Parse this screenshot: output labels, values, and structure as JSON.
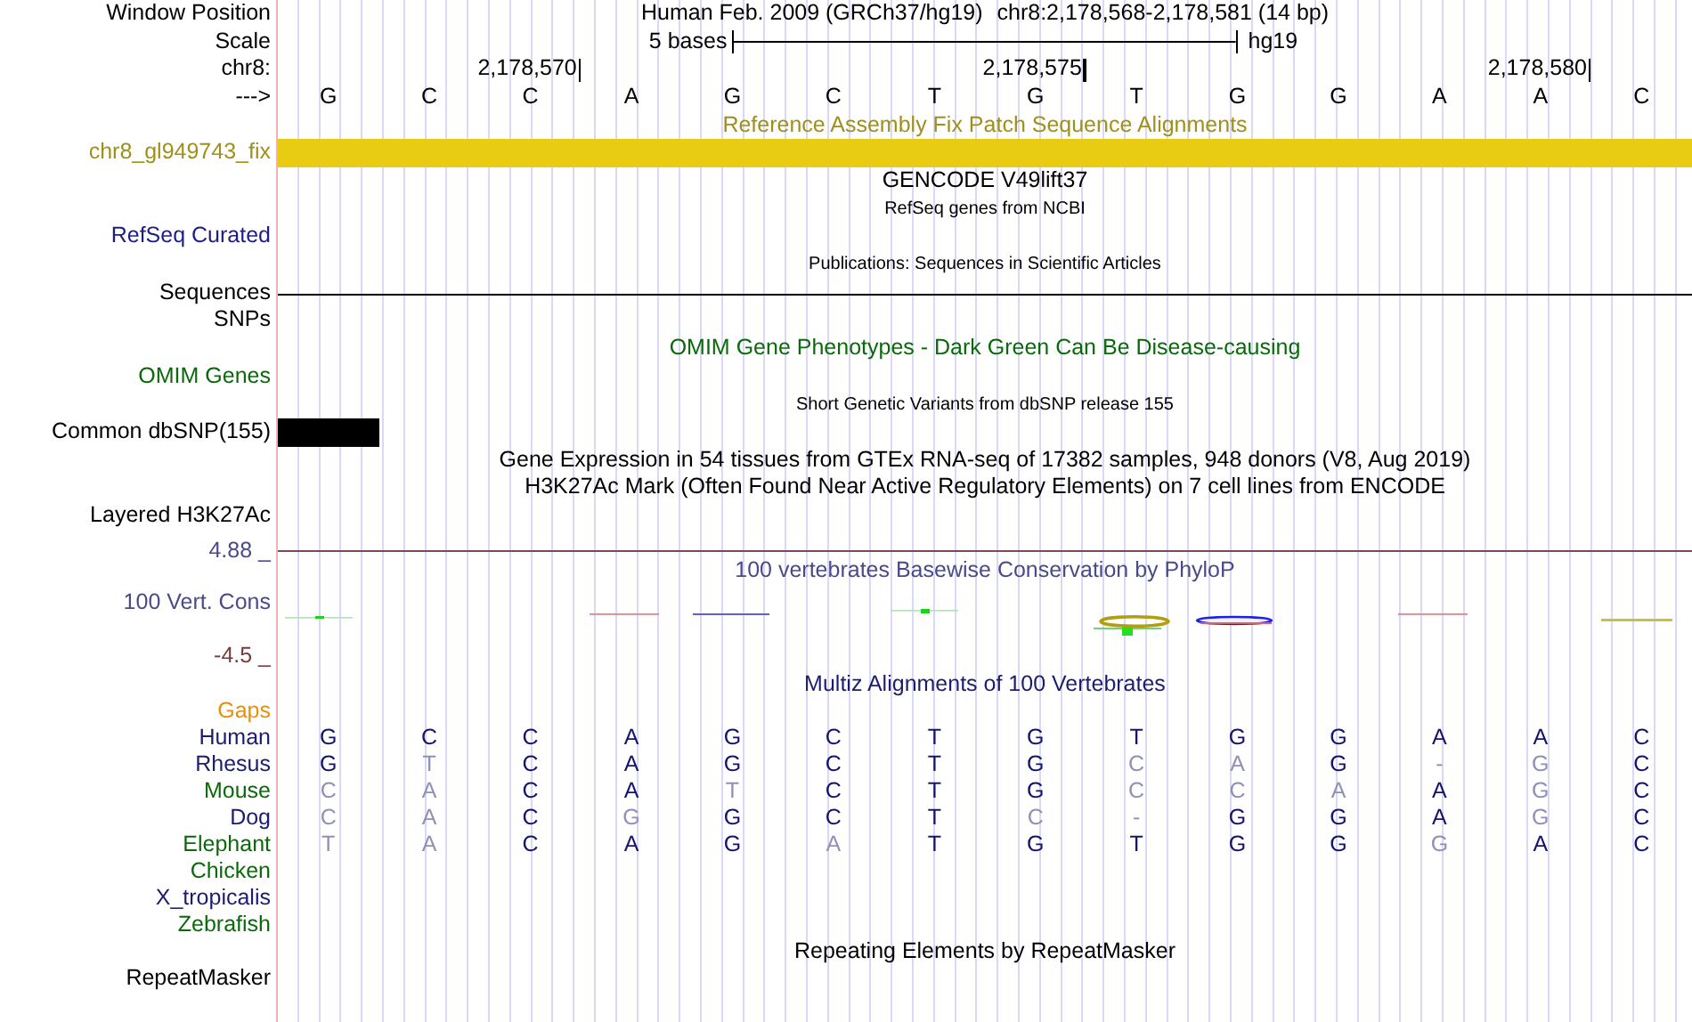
{
  "rows": [
    {
      "kind": "position",
      "label": "Window Position",
      "title": "Human Feb. 2009 (GRCh37/hg19)",
      "region": "chr8:2,178,568-2,178,581 (14 bp)"
    },
    {
      "kind": "scale",
      "label": "Scale",
      "scale_text": "5 bases",
      "assembly": "hg19"
    },
    {
      "kind": "coords",
      "label": "chr8:",
      "ticks": [
        "2,178,570",
        "2,178,575",
        "2,178,580"
      ]
    },
    {
      "kind": "bases",
      "label": "--->",
      "bases": [
        "G",
        "C",
        "C",
        "A",
        "G",
        "C",
        "T",
        "G",
        "T",
        "G",
        "G",
        "A",
        "A",
        "C"
      ]
    },
    {
      "kind": "title",
      "title": "Reference Assembly Fix Patch Sequence Alignments",
      "color": "#a0901a"
    },
    {
      "kind": "bar",
      "label": "chr8_gl949743_fix",
      "color": "#a0901a"
    },
    {
      "kind": "title",
      "title": "GENCODE V49lift37",
      "color": "#000000"
    },
    {
      "kind": "subtitle",
      "title": "RefSeq genes from NCBI"
    },
    {
      "kind": "label",
      "label": "RefSeq Curated",
      "color": "#1c1c8c"
    },
    {
      "kind": "subtitle",
      "title": "Publications: Sequences in Scientific Articles"
    },
    {
      "kind": "line",
      "label": "Sequences"
    },
    {
      "kind": "label",
      "label": "SNPs",
      "color": "#000000"
    },
    {
      "kind": "title",
      "title": "OMIM Gene Phenotypes - Dark Green Can Be Disease-causing",
      "color": "#0a6a0a"
    },
    {
      "kind": "label",
      "label": "OMIM Genes",
      "color": "#0a6a0a"
    },
    {
      "kind": "subtitle",
      "title": "Short Genetic Variants from dbSNP release 155"
    },
    {
      "kind": "snp",
      "label": "Common dbSNP(155)"
    },
    {
      "kind": "title",
      "title": "Gene Expression in 54 tissues from GTEx RNA-seq of 17382 samples, 948 donors (V8, Aug 2019)",
      "color": "#000000"
    },
    {
      "kind": "title",
      "title": "H3K27Ac Mark (Often Found Near Active Regulatory Elements) on 7 cell lines from ENCODE",
      "color": "#000000"
    },
    {
      "kind": "label",
      "label": "Layered H3K27Ac",
      "color": "#000000"
    },
    {
      "kind": "phylop",
      "label": "100 Vert. Cons",
      "title": "100 vertebrates Basewise Conservation by PhyloP",
      "max": "4.88 _",
      "min": "-4.5 _"
    },
    {
      "kind": "title",
      "title": "Multiz Alignments of 100 Vertebrates",
      "color": "#1c1c70"
    },
    {
      "kind": "label",
      "label": "Gaps",
      "color": "#e8900a"
    },
    {
      "kind": "species",
      "label": "Human",
      "color": "#1c1c70",
      "bases": [
        {
          "b": "G",
          "match": true
        },
        {
          "b": "C",
          "match": true
        },
        {
          "b": "C",
          "match": true
        },
        {
          "b": "A",
          "match": true
        },
        {
          "b": "G",
          "match": true
        },
        {
          "b": "C",
          "match": true
        },
        {
          "b": "T",
          "match": true
        },
        {
          "b": "G",
          "match": true
        },
        {
          "b": "T",
          "match": true
        },
        {
          "b": "G",
          "match": true
        },
        {
          "b": "G",
          "match": true
        },
        {
          "b": "A",
          "match": true
        },
        {
          "b": "A",
          "match": true
        },
        {
          "b": "C",
          "match": true
        }
      ]
    },
    {
      "kind": "species",
      "label": "Rhesus",
      "color": "#1c1c70",
      "bases": [
        {
          "b": "G",
          "match": true
        },
        {
          "b": "T",
          "match": false
        },
        {
          "b": "C",
          "match": true
        },
        {
          "b": "A",
          "match": true
        },
        {
          "b": "G",
          "match": true
        },
        {
          "b": "C",
          "match": true
        },
        {
          "b": "T",
          "match": true
        },
        {
          "b": "G",
          "match": true
        },
        {
          "b": "C",
          "match": false
        },
        {
          "b": "A",
          "match": false
        },
        {
          "b": "G",
          "match": true
        },
        {
          "b": "-",
          "match": false
        },
        {
          "b": "G",
          "match": false
        },
        {
          "b": "C",
          "match": true
        }
      ]
    },
    {
      "kind": "species",
      "label": "Mouse",
      "color": "#0a6a0a",
      "bases": [
        {
          "b": "C",
          "match": false
        },
        {
          "b": "A",
          "match": false
        },
        {
          "b": "C",
          "match": true
        },
        {
          "b": "A",
          "match": true
        },
        {
          "b": "T",
          "match": false
        },
        {
          "b": "C",
          "match": true
        },
        {
          "b": "T",
          "match": true
        },
        {
          "b": "G",
          "match": true
        },
        {
          "b": "C",
          "match": false
        },
        {
          "b": "C",
          "match": false
        },
        {
          "b": "A",
          "match": false
        },
        {
          "b": "A",
          "match": true
        },
        {
          "b": "G",
          "match": false
        },
        {
          "b": "C",
          "match": true
        }
      ]
    },
    {
      "kind": "species",
      "label": "Dog",
      "color": "#1c1c70",
      "bases": [
        {
          "b": "C",
          "match": false
        },
        {
          "b": "A",
          "match": false
        },
        {
          "b": "C",
          "match": true
        },
        {
          "b": "G",
          "match": false
        },
        {
          "b": "G",
          "match": true
        },
        {
          "b": "C",
          "match": true
        },
        {
          "b": "T",
          "match": true
        },
        {
          "b": "C",
          "match": false
        },
        {
          "b": "-",
          "match": false
        },
        {
          "b": "G",
          "match": true
        },
        {
          "b": "G",
          "match": true
        },
        {
          "b": "A",
          "match": true
        },
        {
          "b": "G",
          "match": false
        },
        {
          "b": "C",
          "match": true
        }
      ]
    },
    {
      "kind": "species",
      "label": "Elephant",
      "color": "#0a6a0a",
      "bases": [
        {
          "b": "T",
          "match": false
        },
        {
          "b": "A",
          "match": false
        },
        {
          "b": "C",
          "match": true
        },
        {
          "b": "A",
          "match": true
        },
        {
          "b": "G",
          "match": true
        },
        {
          "b": "A",
          "match": false
        },
        {
          "b": "T",
          "match": true
        },
        {
          "b": "G",
          "match": true
        },
        {
          "b": "T",
          "match": true
        },
        {
          "b": "G",
          "match": true
        },
        {
          "b": "G",
          "match": true
        },
        {
          "b": "G",
          "match": false
        },
        {
          "b": "A",
          "match": true
        },
        {
          "b": "C",
          "match": true
        }
      ]
    },
    {
      "kind": "species",
      "label": "Chicken",
      "color": "#0a6a0a"
    },
    {
      "kind": "species",
      "label": "X_tropicalis",
      "color": "#1c1c70"
    },
    {
      "kind": "species",
      "label": "Zebrafish",
      "color": "#0a6a0a"
    },
    {
      "kind": "title",
      "title": "Repeating Elements by RepeatMasker",
      "color": "#000000"
    },
    {
      "kind": "label",
      "label": "RepeatMasker",
      "color": "#000000"
    }
  ]
}
